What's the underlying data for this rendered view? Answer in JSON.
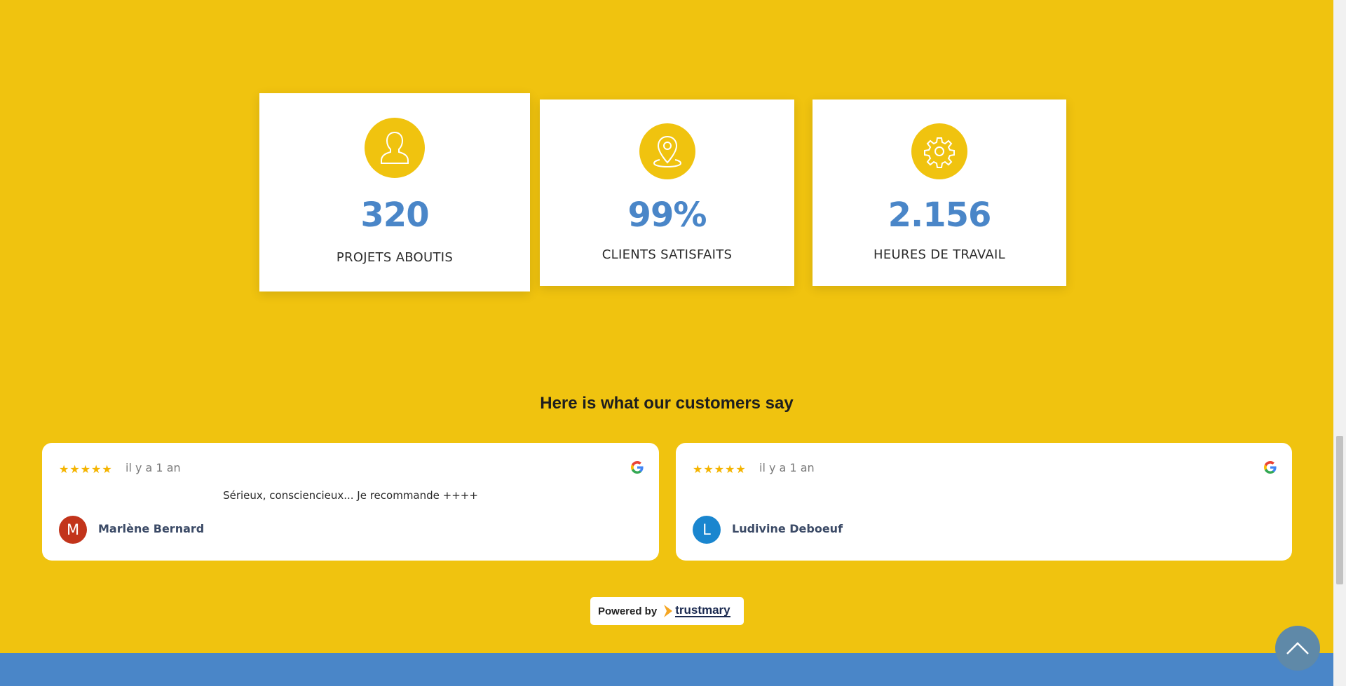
{
  "stats": [
    {
      "icon": "user-icon",
      "value": "320",
      "label": "PROJETS ABOUTIS"
    },
    {
      "icon": "location-pin-icon",
      "value": "99%",
      "label": "CLIENTS SATISFAITS"
    },
    {
      "icon": "gear-icon",
      "value": "2.156",
      "label": "HEURES DE TRAVAIL"
    }
  ],
  "reviews": {
    "heading": "Here is what our customers say",
    "items": [
      {
        "rating": 5,
        "stars": "★★★★★",
        "time": "il y a 1 an",
        "text": "Sérieux, consciencieux... Je recommande ++++",
        "avatar_letter": "M",
        "avatar_color": "#C2341B",
        "name": "Marlène Bernard",
        "source_icon": "google-icon"
      },
      {
        "rating": 5,
        "stars": "★★★★★",
        "time": "il y a 1 an",
        "text": "",
        "avatar_letter": "L",
        "avatar_color": "#1A86CF",
        "name": "Ludivine Deboeuf",
        "source_icon": "google-icon"
      }
    ]
  },
  "powered": {
    "prefix": "Powered by",
    "brand": "trustmary"
  },
  "colors": {
    "background": "#F0C30F",
    "accent_blue": "#4A86C8",
    "scroll_top": "#5F89A8"
  }
}
